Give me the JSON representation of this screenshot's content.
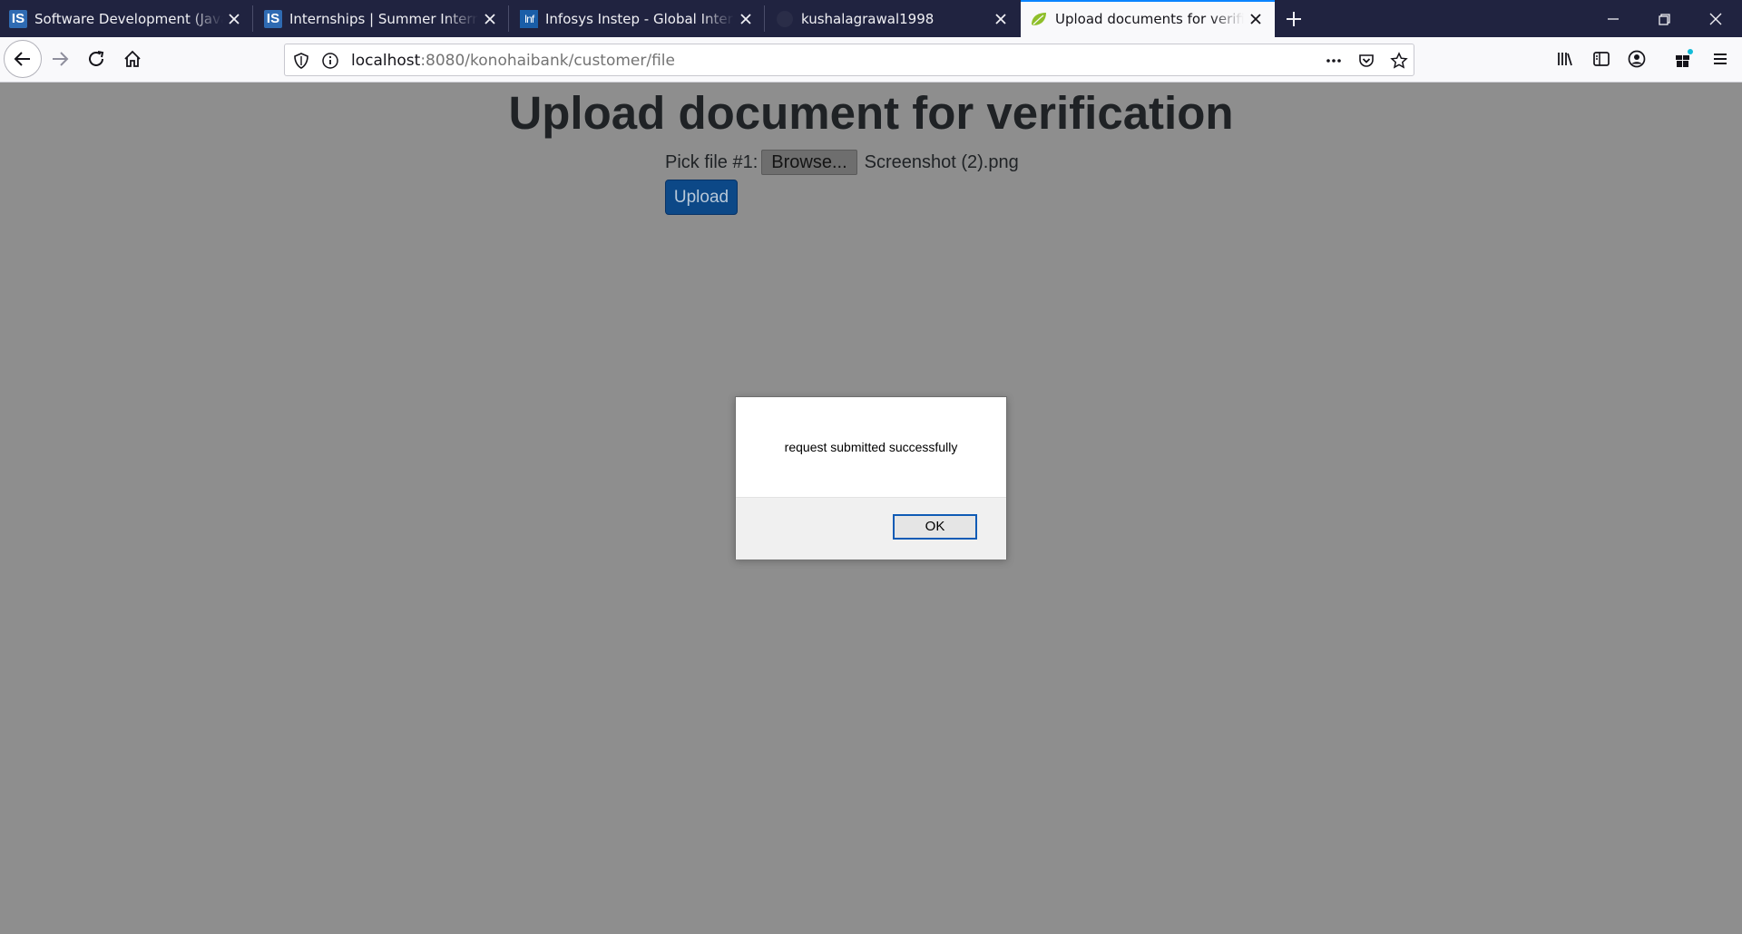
{
  "browser": {
    "tabs": [
      {
        "title": "Software Development (Java) w",
        "favicon": "is-logo-icon",
        "active": false
      },
      {
        "title": "Internships | Summer Internship",
        "favicon": "is-logo-icon",
        "active": false
      },
      {
        "title": "Infosys Instep - Global Internsh",
        "favicon": "infosys-icon",
        "active": false
      },
      {
        "title": "kushalagrawal1998",
        "favicon": "github-icon",
        "active": false
      },
      {
        "title": "Upload documents for verificat",
        "favicon": "spring-leaf-icon",
        "active": true
      }
    ],
    "favicon_text": {
      "is": "IS",
      "infosys": "Inf"
    },
    "url_host": "localhost",
    "url_rest": ":8080/konohaibank/customer/file",
    "accent_color": "#0a84ff"
  },
  "page": {
    "heading": "Upload document for verification",
    "file_label": "Pick file #1:",
    "browse_label": "Browse...",
    "file_name": "Screenshot (2).png",
    "upload_label": "Upload",
    "upload_color": "#0c4887"
  },
  "alert": {
    "message": "request submitted successfully",
    "ok_label": "OK"
  }
}
